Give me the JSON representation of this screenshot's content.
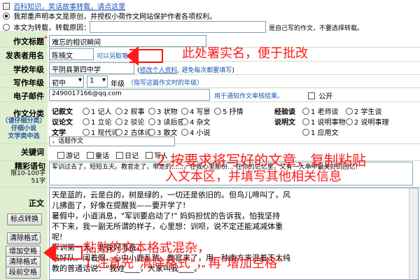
{
  "top_links": {
    "hundred_tips": "百科知识，笑话故事转载，请点这里",
    "original_declare": "我郑重声明本文是原创，并授权小荷作文网站保护作者各项权利。",
    "repost_prefix": "本文为转载，转载原因：",
    "repost_suffix": "是自己写的作文，不要选择转载。"
  },
  "fields": {
    "title_label": "作文标题",
    "title_value": "难忘的相识瞬间",
    "author_label": "发表者用名",
    "author_value": "陈楠文",
    "author_hint": "可以另取笔名",
    "school_label": "学校年级",
    "school_value": "平阴县第四中学",
    "school_link": "修改个人资料",
    "school_hint": "避免每次都要填写",
    "grade_label": "写作年级",
    "grade_value": "初中",
    "grade_num": "1",
    "grade_unit": "年级",
    "grade_hint": "（指写这篇作文时的年级）",
    "email_label": "电子邮件",
    "email_value": "2490017166@qq.com",
    "email_hint": "用于通知作文审核结果。",
    "public_label": "公开"
  },
  "category": {
    "label": "作文分类",
    "sub1": "（请仔细分类）",
    "sub2": "仔细小说",
    "sub3": "文学类中选",
    "rows": [
      {
        "name": "记叙文",
        "opts": [
          "1 记人",
          "2 叙事",
          "3 状物",
          "4 写景",
          "5 抒情"
        ]
      },
      {
        "name": "议论文",
        "opts": [
          "1 立论",
          "2 驳论",
          "3 读后感",
          "4 杂文"
        ]
      },
      {
        "name": "文学",
        "opts": [
          "1 现代诗",
          "2 古体诗",
          "3 散文",
          "4 小说"
        ]
      }
    ],
    "right_rows": [
      {
        "name": "经验谈",
        "opts": [
          "1 老师谈",
          "2 学生谈"
        ]
      },
      {
        "name": "说明文",
        "opts": [
          "1 说明事物",
          "2 说明事理"
        ]
      },
      {
        "name": "",
        "opts": [
          "1 应用文"
        ]
      }
    ]
  },
  "keywords": {
    "label": "关键词",
    "value": "，话题作文",
    "checks": [
      "游记",
      "童话",
      "日记",
      "写人"
    ]
  },
  "summary": {
    "label": "精彩语句",
    "hint": "限10-100字",
    "count": "51字",
    "text": "军训过去了，短短五天。教官走了，带走的......，在我心里那份... 在你的记忆里，又有一大串中最美好的回忆!"
  },
  "body": {
    "label": "正文",
    "lines": [
      "天是蓝的，云是白的，树是绿的，一切还是依旧的。但鸟儿啼叫了，风",
      "儿拂面了，好像在提醒我——要开学了!",
      "暑假中，小道消息，\"军训要启动了!\" 妈妈担忧的告诉我，怕我坚持",
      "不下来，我一副无所谓的样子，心里想：训呗，说不定还能减减体重",
      "呢!",
      "军训第一天，我做好准备，...，...，...",
      "站好队，闭着眼，心中小鹿乱跳。教官来了，用一种南方来混着不太纯",
      "教的普通话说：\"我姓____，大家叫我____。\""
    ]
  },
  "buttons": {
    "convert": "标点转换",
    "clear_format": "清除格式",
    "add_space": "增加空格",
    "clear_format2": "清除格式",
    "paragraph": "段前空格"
  },
  "annotations": {
    "a1": "此处署实名，便于批改",
    "a2_line1": "2 按要求将写好的文章，复制粘贴",
    "a2_line2": "入文本区，并填写其他相关信息",
    "a3_line1": "粘贴的文本格式混杂，",
    "a3_line2": "1 注意先\"清除格式\"，再\"增加空格\""
  },
  "colors": {
    "label_bg": "#dfeecf",
    "annotation": "#ff1a1a",
    "link": "#1a55b5"
  }
}
